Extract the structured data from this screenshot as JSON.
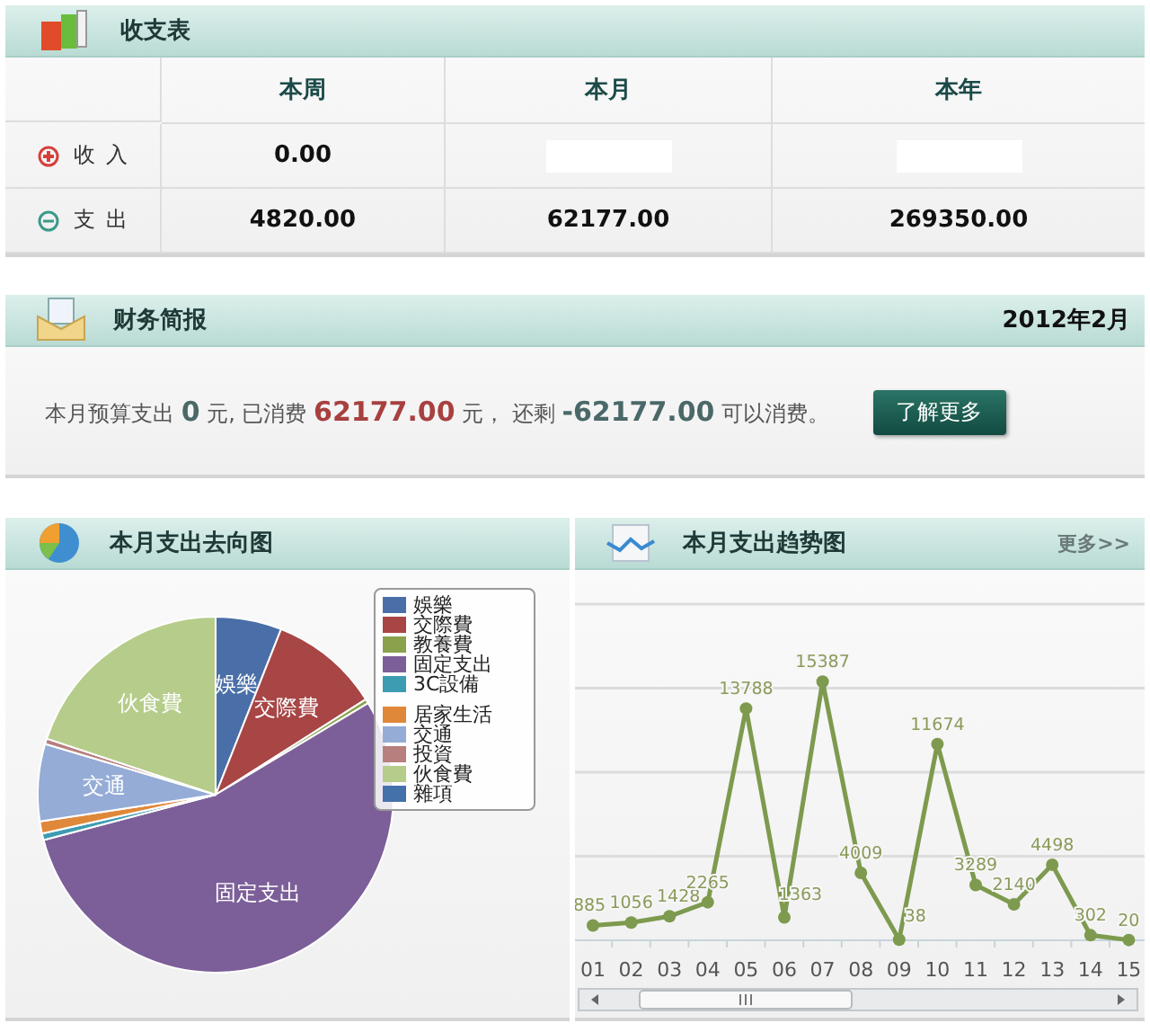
{
  "income_table": {
    "title": "收支表",
    "columns": [
      "本周",
      "本月",
      "本年"
    ],
    "rows": [
      {
        "kind": "income",
        "label": "收入",
        "cells": [
          {
            "text": "0.00"
          },
          {
            "blanked": true
          },
          {
            "blanked": true
          }
        ]
      },
      {
        "kind": "expense",
        "label": "支出",
        "cells": [
          {
            "text": "4820.00"
          },
          {
            "text": "62177.00"
          },
          {
            "text": "269350.00"
          }
        ]
      }
    ]
  },
  "report": {
    "title": "财务简报",
    "date": "2012年2月",
    "summary": [
      {
        "kind": "plain",
        "text": "本月预算支出 "
      },
      {
        "kind": "budget",
        "text": "0"
      },
      {
        "kind": "plain",
        "text": " 元, 已消费 "
      },
      {
        "kind": "spent",
        "text": "62177.00"
      },
      {
        "kind": "plain",
        "text": " 元， 还剩 "
      },
      {
        "kind": "remaining",
        "text": "-62177.00"
      },
      {
        "kind": "plain",
        "text": " 可以消费。"
      }
    ],
    "button": "了解更多"
  },
  "pie_panel": {
    "title": "本月支出去向图",
    "legend": [
      {
        "name": "娛樂",
        "color": "#4a6fa8",
        "slice_label": "娛樂"
      },
      {
        "name": "交際費",
        "color": "#a84545",
        "slice_label": "交際費"
      },
      {
        "name": "教養費",
        "color": "#8aa24c"
      },
      {
        "name": "固定支出",
        "color": "#7c5f98",
        "slice_label": "固定支出"
      },
      {
        "name": "3C設備",
        "color": "#3c9cb2"
      },
      {
        "name": "居家生活",
        "color": "#e0883a"
      },
      {
        "name": "交通",
        "color": "#94acd6",
        "slice_label": "交通"
      },
      {
        "name": "投資",
        "color": "#b87f7f"
      },
      {
        "name": "伙食費",
        "color": "#b6cc8a",
        "slice_label": "伙食費"
      },
      {
        "name": "雜項",
        "color": "#4471aa"
      }
    ]
  },
  "trend_panel": {
    "title": "本月支出趋势图",
    "more_link": "更多>>",
    "chart_data": {
      "type": "line",
      "categories": [
        "01",
        "02",
        "03",
        "04",
        "05",
        "06",
        "07",
        "08",
        "09",
        "10",
        "11",
        "12",
        "13",
        "14",
        "15"
      ],
      "data_labels": true,
      "series": [
        {
          "color": "#7d9a4e",
          "marker": true,
          "values": [
            885,
            1056,
            1428,
            2265,
            13788,
            1363,
            15387,
            4009,
            38,
            11674,
            3289,
            2140,
            4498,
            302,
            20
          ]
        }
      ]
    }
  }
}
